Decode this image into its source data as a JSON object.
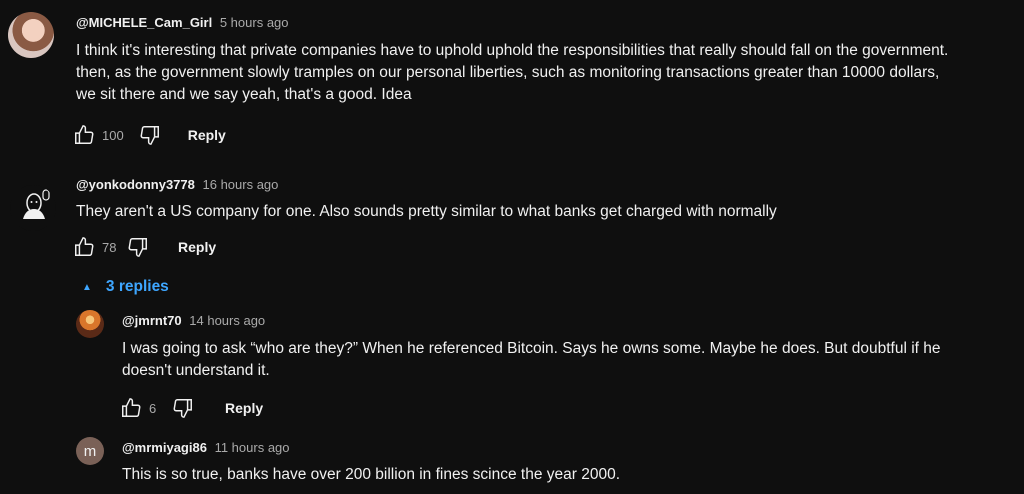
{
  "comments": [
    {
      "author": "@MICHELE_Cam_Girl",
      "time": "5 hours ago",
      "text_lines": [
        "I think it's interesting that private companies have to uphold uphold the responsibilities that really should fall on the government.",
        "then, as the government slowly tramples on our personal liberties, such as monitoring transactions greater than 10000 dollars,",
        "we sit there and we say yeah, that's a good. Idea"
      ],
      "likes": "100",
      "reply_label": "Reply",
      "avatar_icon": "user-photo-avatar"
    },
    {
      "author": "@yonkodonny3778",
      "time": "16 hours ago",
      "text_lines": [
        "They aren't a US company for one. Also sounds pretty similar to what banks get charged with normally"
      ],
      "likes": "78",
      "reply_label": "Reply",
      "avatar_icon": "drawn-face-avatar"
    }
  ],
  "replies_toggle": {
    "label": "3 replies",
    "icon": "caret-up-icon",
    "color": "#3ea6ff"
  },
  "replies": [
    {
      "author": "@jmrnt70",
      "time": "14 hours ago",
      "text_lines": [
        "I was going to ask “who are they?” When he referenced Bitcoin. Says he owns some. Maybe he does. But doubtful if he",
        "doesn't understand it."
      ],
      "likes": "6",
      "reply_label": "Reply",
      "avatar_icon": "sunset-avatar"
    },
    {
      "author": "@mrmiyagi86",
      "time": "11 hours ago",
      "avatar_letter": "m",
      "text_lines": [
        "This is so true, banks have over 200 billion in fines scince the year 2000."
      ]
    }
  ],
  "colors": {
    "background": "#0f0f0f",
    "text": "#f1f1f1",
    "secondary": "#aaaaaa",
    "link": "#3ea6ff"
  }
}
